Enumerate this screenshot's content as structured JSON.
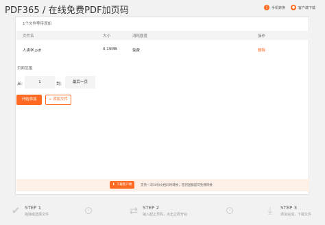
{
  "header": {
    "title": "PDF365 / 在线免费PDF加页码",
    "mobile_label": "手机转换",
    "service_label": "客户端下载"
  },
  "panel": {
    "files_count": "1个文件等待添加",
    "table": {
      "headers": [
        "文件名",
        "大小",
        "消耗额度",
        "操作"
      ],
      "rows": [
        {
          "name": "人类学.pdf",
          "size": "0.19MB",
          "cost": "免费",
          "action": "删除"
        }
      ]
    },
    "range": {
      "label": "页面范围",
      "from_label": "从:",
      "from_value": "1",
      "to_label": "到:",
      "to_value": "最后一页"
    },
    "start_button": "开始添加",
    "add_file_button": "+ 添加文件",
    "notice": {
      "download_button": "下载客户端",
      "text": "支持一次50份文档同时转换，签到送额度可免费转换"
    }
  },
  "steps": [
    {
      "name": "STEP 1",
      "desc": "拖拽或选择文件",
      "icon": "upload-check-icon"
    },
    {
      "name": "STEP 2",
      "desc": "输入起止页码，点击立即开始",
      "icon": "convert-arrows-icon"
    },
    {
      "name": "STEP 3",
      "desc": "添加完成，下载文件",
      "icon": "download-icon"
    }
  ],
  "colors": {
    "accent": "#ff6a22",
    "notice_bg": "#fdf1e7"
  }
}
